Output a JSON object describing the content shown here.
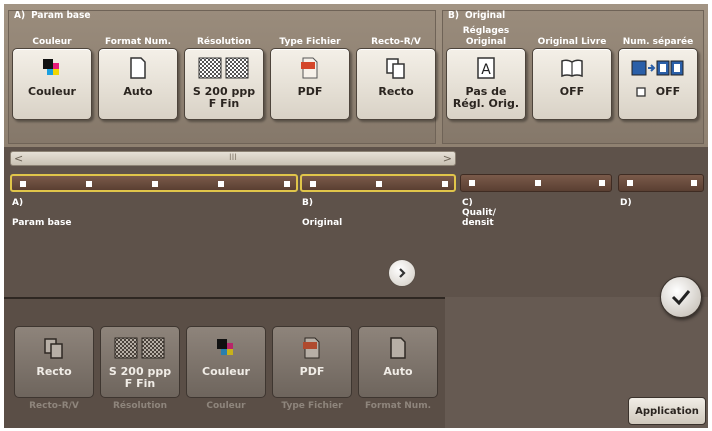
{
  "top": {
    "group_a": {
      "letter": "A)",
      "title": "Param base"
    },
    "group_b": {
      "letter": "B)",
      "title": "Original"
    },
    "functions": [
      {
        "label": "Couleur",
        "value": "Couleur",
        "icon": "color-icon"
      },
      {
        "label": "Format Num.",
        "value": "Auto",
        "icon": "page-icon"
      },
      {
        "label": "Résolution",
        "value": "S 200 ppp\nF Fin",
        "icon": "resolution-icon"
      },
      {
        "label": "Type Fichier",
        "value": "PDF",
        "icon": "pdf-icon"
      },
      {
        "label": "Recto-R/V",
        "value": "Recto",
        "icon": "recto-icon"
      },
      {
        "label": "Réglages\nOriginal",
        "value": "Pas de\nRégl. Orig.",
        "icon": "letter-a-icon"
      },
      {
        "label": "Original Livre",
        "value": "OFF",
        "icon": "book-icon"
      },
      {
        "label": "Num. séparée",
        "value": "OFF",
        "icon": "separate-scan-icon"
      }
    ]
  },
  "scrollbar": {
    "left": "<",
    "right": ">",
    "mark": "III"
  },
  "sections": [
    {
      "letter": "A)",
      "label": "Param base"
    },
    {
      "letter": "B)",
      "label": "Original"
    },
    {
      "letter": "C)",
      "label": "Qualit/\ndensit"
    },
    {
      "letter": "D)",
      "label": ""
    }
  ],
  "summary": [
    {
      "value": "Recto",
      "label": "Recto-R/V",
      "icon": "recto-icon"
    },
    {
      "value": "S 200 ppp\nF Fin",
      "label": "Résolution",
      "icon": "resolution-icon"
    },
    {
      "value": "Couleur",
      "label": "Couleur",
      "icon": "color-icon"
    },
    {
      "value": "PDF",
      "label": "Type Fichier",
      "icon": "pdf-icon"
    },
    {
      "value": "Auto",
      "label": "Format Num.",
      "icon": "page-icon"
    }
  ],
  "apply_label": "Application",
  "next_icon": "chevron-right-icon",
  "ok_icon": "checkmark-icon"
}
